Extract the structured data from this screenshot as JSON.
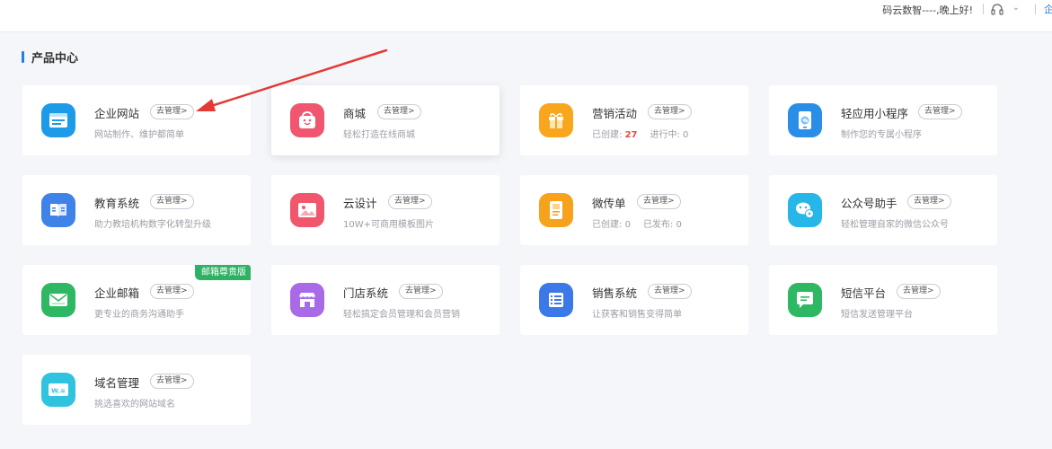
{
  "header": {
    "greeting": "码云数智----,晚上好!",
    "corner_text": "企"
  },
  "section": {
    "title": "产品中心"
  },
  "products": [
    {
      "name": "企业网站",
      "manage": "去管理>",
      "desc": "网站制作、维护都简单",
      "icon": "website-icon",
      "color": "#1e9be8"
    },
    {
      "name": "商城",
      "manage": "去管理>",
      "desc": "轻松打造在线商城",
      "icon": "shop-bag-icon",
      "color": "#f05670"
    },
    {
      "name": "营销活动",
      "manage": "去管理>",
      "desc_created_label": "已创建:",
      "desc_created_value": "27",
      "desc_running_label": "进行中:",
      "desc_running_value": "0",
      "icon": "gift-icon",
      "color": "#f7a61d"
    },
    {
      "name": "轻应用小程序",
      "manage": "去管理>",
      "desc": "制作您的专属小程序",
      "icon": "mini-program-icon",
      "color": "#2a8ee8"
    },
    {
      "name": "教育系统",
      "manage": "去管理>",
      "desc": "助力教培机构数字化转型升级",
      "icon": "book-icon",
      "color": "#3f82e8"
    },
    {
      "name": "云设计",
      "manage": "去管理>",
      "desc": "10W+可商用模板图片",
      "icon": "image-icon",
      "color": "#f0566c"
    },
    {
      "name": "微传单",
      "manage": "去管理>",
      "desc_created_label": "已创建:",
      "desc_created_value": "0",
      "desc_published_label": "已发布:",
      "desc_published_value": "0",
      "icon": "flyer-icon",
      "color": "#f7a21d"
    },
    {
      "name": "公众号助手",
      "manage": "去管理>",
      "desc": "轻松管理自家的微信公众号",
      "icon": "wechat-icon",
      "color": "#27b6e8"
    },
    {
      "name": "企业邮箱",
      "manage": "去管理>",
      "desc": "更专业的商务沟通助手",
      "badge": "邮箱尊贵版",
      "icon": "mail-icon",
      "color": "#2fb864"
    },
    {
      "name": "门店系统",
      "manage": "去管理>",
      "desc": "轻松搞定会员管理和会员营销",
      "icon": "store-icon",
      "color": "#a96ae8"
    },
    {
      "name": "销售系统",
      "manage": "去管理>",
      "desc": "让获客和销售变得简单",
      "icon": "list-icon",
      "color": "#3b78e8"
    },
    {
      "name": "短信平台",
      "manage": "去管理>",
      "desc": "短信发送管理平台",
      "icon": "sms-icon",
      "color": "#2fb864"
    },
    {
      "name": "域名管理",
      "manage": "去管理>",
      "desc": "挑选喜欢的网站域名",
      "icon": "domain-icon",
      "color": "#30c3e0"
    }
  ]
}
